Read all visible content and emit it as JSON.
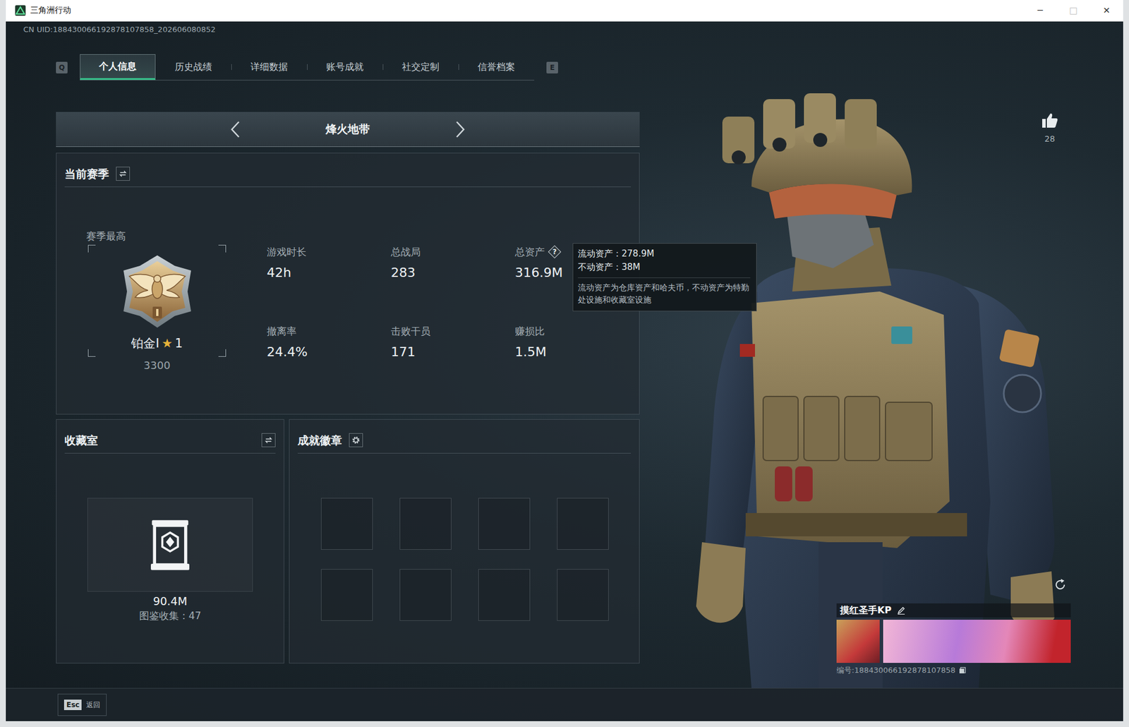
{
  "window": {
    "title": "三角洲行动",
    "controls": [
      {
        "glyph": "─",
        "disabled": false
      },
      {
        "glyph": "□",
        "disabled": true
      },
      {
        "glyph": "✕",
        "disabled": false
      }
    ]
  },
  "uid": "CN UID:188430066192878107858_202606080852",
  "tabs": {
    "prev_key": "Q",
    "next_key": "E",
    "items": [
      {
        "label": "个人信息",
        "selected": true
      },
      {
        "label": "历史战绩",
        "selected": false
      },
      {
        "label": "详细数据",
        "selected": false
      },
      {
        "label": "账号成就",
        "selected": false
      },
      {
        "label": "社交定制",
        "selected": false
      },
      {
        "label": "信誉档案",
        "selected": false
      }
    ]
  },
  "mode": {
    "label": "烽火地带"
  },
  "season": {
    "title": "当前赛季",
    "best_label": "赛季最高",
    "rank": "铂金I",
    "star": "★",
    "star_count": "1",
    "score": "3300",
    "stats": [
      {
        "label": "游戏时长",
        "value": "42h",
        "help": ""
      },
      {
        "label": "总战局",
        "value": "283",
        "help": ""
      },
      {
        "label": "总资产",
        "value": "316.9M",
        "help": "?"
      },
      {
        "label": "撤离率",
        "value": "24.4%",
        "help": ""
      },
      {
        "label": "击败干员",
        "value": "171",
        "help": ""
      },
      {
        "label": "赚损比",
        "value": "1.5M",
        "help": ""
      }
    ]
  },
  "tooltip": {
    "lines": [
      "流动资产：278.9M",
      "不动资产：38M"
    ],
    "note": "流动资产为仓库资产和哈夫币，不动资产为特勤处设施和收藏室设施"
  },
  "collection": {
    "title": "收藏室",
    "value": "90.4M",
    "caption": "图鉴收集：47"
  },
  "achievements": {
    "title": "成就徽章",
    "slots": [
      {
        "filled": false
      },
      {
        "filled": false
      },
      {
        "filled": false
      },
      {
        "filled": false
      },
      {
        "filled": false
      },
      {
        "filled": false
      },
      {
        "filled": false
      },
      {
        "filled": false
      }
    ]
  },
  "likes": {
    "count": "28"
  },
  "player": {
    "name": "摸红圣手KP",
    "id": "编号:188430066192878107858"
  },
  "footer": {
    "key": "Esc",
    "label": "返回"
  }
}
